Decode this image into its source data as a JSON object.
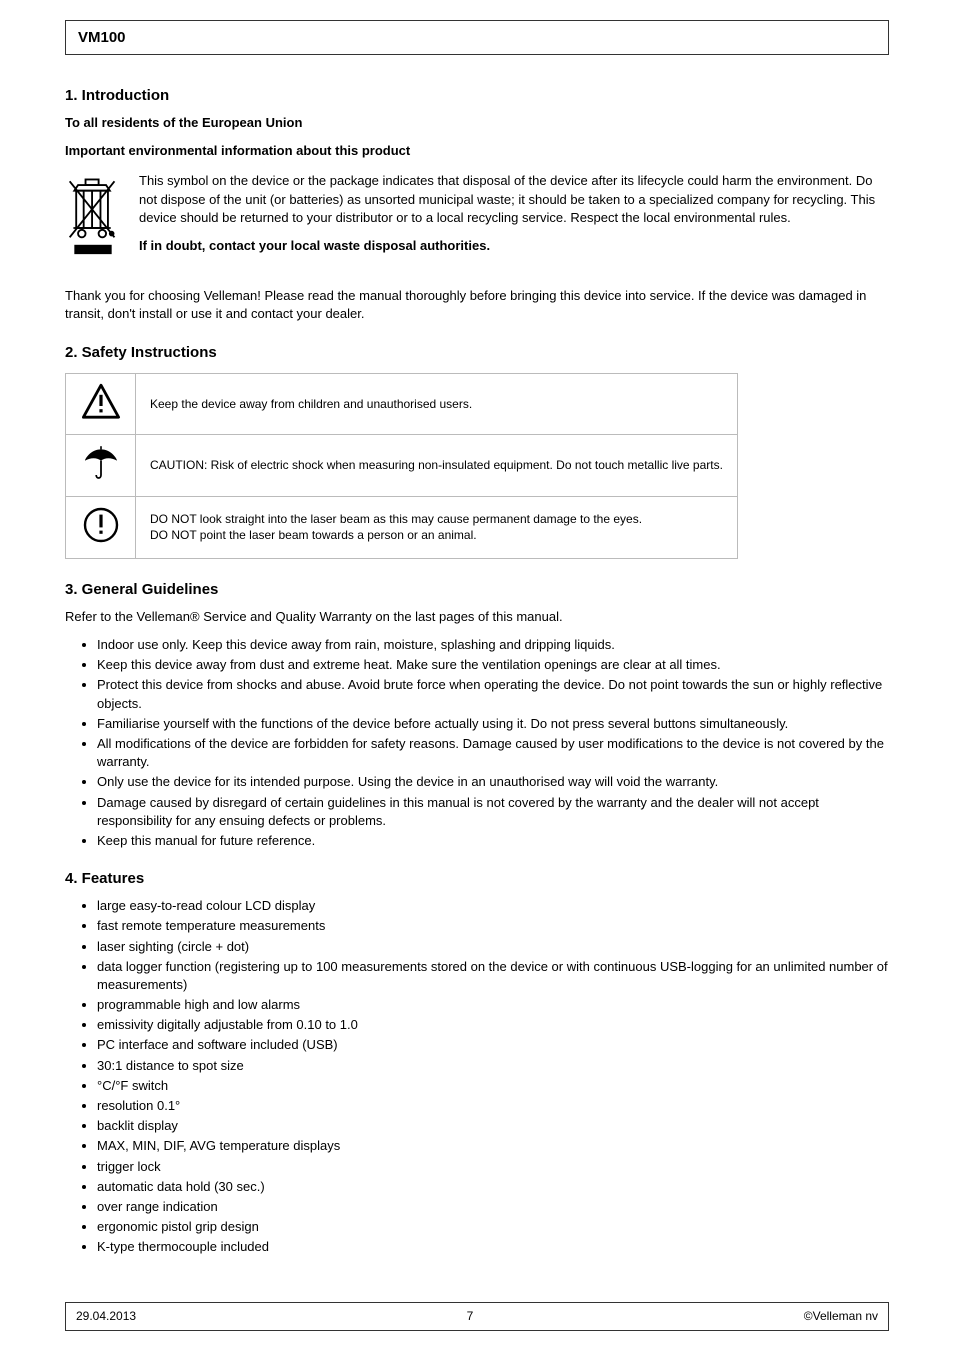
{
  "header": {
    "product": "VM100"
  },
  "sections": {
    "intro_title": "1. Introduction",
    "intro_to": "To all residents of the European Union",
    "intro_info": "Important environmental information about this product",
    "weee_text": "This symbol on the device or the package indicates that disposal of the device after its lifecycle could harm the environment. Do not dispose of the unit (or batteries) as unsorted municipal waste; it should be taken to a specialized company for recycling. This device should be returned to your distributor or to a local recycling service. Respect the local environmental rules.",
    "weee_doubt": "If in doubt, contact your local waste disposal authorities.",
    "thanks": "Thank you for choosing Velleman! Please read the manual thoroughly before bringing this device into service. If the device was damaged in transit, don't install or use it and contact your dealer.",
    "safety_title": "2. Safety Instructions",
    "general_title": "3. General Guidelines",
    "general_ref": "Refer to the Velleman® Service and Quality Warranty on the last pages of this manual.",
    "general_list": [
      "Indoor use only. Keep this device away from rain, moisture, splashing and dripping liquids.",
      "Keep this device away from dust and extreme heat. Make sure the ventilation openings are clear at all times.",
      "Protect this device from shocks and abuse. Avoid brute force when operating the device. Do not point towards the sun or highly reflective objects.",
      "Familiarise yourself with the functions of the device before actually using it. Do not press several buttons simultaneously.",
      "All modifications of the device are forbidden for safety reasons. Damage caused by user modifications to the device is not covered by the warranty.",
      "Only use the device for its intended purpose. Using the device in an unauthorised way will void the warranty.",
      "Damage caused by disregard of certain guidelines in this manual is not covered by the warranty and the dealer will not accept responsibility for any ensuing defects or problems.",
      "Keep this manual for future reference."
    ],
    "features_title": "4. Features",
    "features_list": [
      "large easy-to-read colour LCD display",
      "fast remote temperature measurements",
      "laser sighting (circle + dot)",
      "data logger function (registering up to 100 measurements stored on the device or with continuous USB-logging for an unlimited number of measurements)",
      "programmable high and low alarms",
      "emissivity digitally adjustable from 0.10 to 1.0",
      "PC interface and software included (USB)",
      "30:1 distance to spot size",
      "°C/°F switch",
      "resolution 0.1°",
      "backlit display",
      "MAX, MIN, DIF, AVG temperature displays",
      "trigger lock",
      "automatic data hold (30 sec.)",
      "over range indication",
      "ergonomic pistol grip design",
      "K-type thermocouple included"
    ]
  },
  "symbol_table": {
    "row1": "Keep the device away from children and unauthorised users.",
    "row2": "CAUTION: Risk of electric shock when measuring non-insulated equipment. Do not touch metallic live parts.",
    "row3_a": "DO NOT look straight into the laser beam as this may cause permanent damage to the eyes.",
    "row3_b": "DO NOT point the laser beam towards a person or an animal."
  },
  "footer": {
    "date": "29.04.2013",
    "copyright": "©Velleman nv",
    "page": "7"
  }
}
